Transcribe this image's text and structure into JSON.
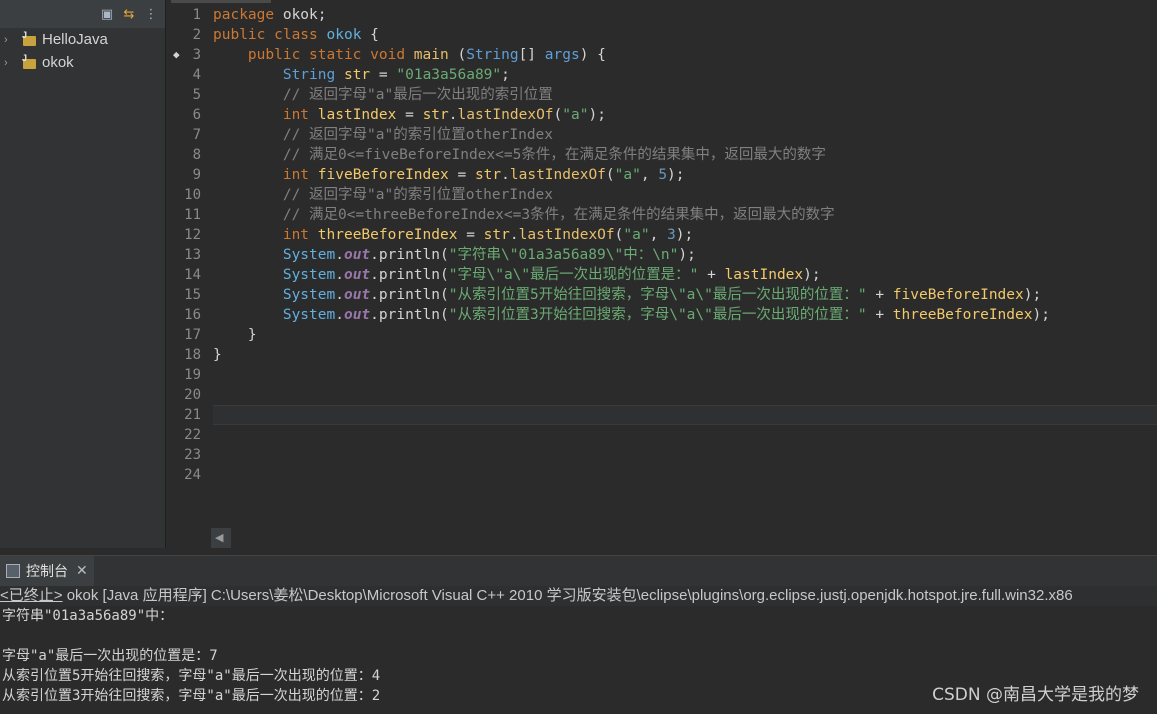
{
  "explorer": {
    "items": [
      {
        "label": "HelloJava"
      },
      {
        "label": "okok"
      }
    ]
  },
  "editor": {
    "line_numbers": [
      "1",
      "2",
      "3",
      "4",
      "5",
      "6",
      "7",
      "8",
      "9",
      "10",
      "11",
      "12",
      "13",
      "14",
      "15",
      "16",
      "17",
      "18",
      "19",
      "20",
      "21",
      "22",
      "23",
      "24"
    ],
    "lines": [
      [
        {
          "t": "package ",
          "c": "kw"
        },
        {
          "t": "okok;",
          "c": ""
        }
      ],
      [
        {
          "t": "public class ",
          "c": "kw"
        },
        {
          "t": "okok",
          "c": "cls"
        },
        {
          "t": " {",
          "c": ""
        }
      ],
      [
        {
          "t": "    public static void ",
          "c": "kw"
        },
        {
          "t": "main",
          "c": "fn"
        },
        {
          "t": " (",
          "c": ""
        },
        {
          "t": "String",
          "c": "type"
        },
        {
          "t": "[] ",
          "c": ""
        },
        {
          "t": "args",
          "c": "type"
        },
        {
          "t": ") {",
          "c": ""
        }
      ],
      [
        {
          "t": "        ",
          "c": ""
        },
        {
          "t": "String",
          "c": "type"
        },
        {
          "t": " ",
          "c": ""
        },
        {
          "t": "str",
          "c": "var"
        },
        {
          "t": " = ",
          "c": ""
        },
        {
          "t": "\"01a3a56a89\"",
          "c": "str"
        },
        {
          "t": ";",
          "c": ""
        }
      ],
      [
        {
          "t": "        // 返回字母\"a\"最后一次出现的索引位置",
          "c": "cm"
        }
      ],
      [
        {
          "t": "        ",
          "c": ""
        },
        {
          "t": "int",
          "c": "kw"
        },
        {
          "t": " ",
          "c": ""
        },
        {
          "t": "lastIndex",
          "c": "var"
        },
        {
          "t": " = ",
          "c": ""
        },
        {
          "t": "str",
          "c": "var"
        },
        {
          "t": ".",
          "c": ""
        },
        {
          "t": "lastIndexOf",
          "c": "fn"
        },
        {
          "t": "(",
          "c": ""
        },
        {
          "t": "\"a\"",
          "c": "str"
        },
        {
          "t": ");",
          "c": ""
        }
      ],
      [
        {
          "t": "        // 返回字母\"a\"的索引位置otherIndex",
          "c": "cm"
        }
      ],
      [
        {
          "t": "        // 满足0<=fiveBeforeIndex<=5条件，在满足条件的结果集中，返回最大的数字",
          "c": "cm"
        }
      ],
      [
        {
          "t": "        ",
          "c": ""
        },
        {
          "t": "int",
          "c": "kw"
        },
        {
          "t": " ",
          "c": ""
        },
        {
          "t": "fiveBeforeIndex",
          "c": "var"
        },
        {
          "t": " = ",
          "c": ""
        },
        {
          "t": "str",
          "c": "var"
        },
        {
          "t": ".",
          "c": ""
        },
        {
          "t": "lastIndexOf",
          "c": "fn"
        },
        {
          "t": "(",
          "c": ""
        },
        {
          "t": "\"a\"",
          "c": "str"
        },
        {
          "t": ", ",
          "c": ""
        },
        {
          "t": "5",
          "c": "num"
        },
        {
          "t": ");",
          "c": ""
        }
      ],
      [
        {
          "t": "        // 返回字母\"a\"的索引位置otherIndex",
          "c": "cm"
        }
      ],
      [
        {
          "t": "        // 满足0<=threeBeforeIndex<=3条件，在满足条件的结果集中，返回最大的数字",
          "c": "cm"
        }
      ],
      [
        {
          "t": "        ",
          "c": ""
        },
        {
          "t": "int",
          "c": "kw"
        },
        {
          "t": " ",
          "c": ""
        },
        {
          "t": "threeBeforeIndex",
          "c": "var"
        },
        {
          "t": " = ",
          "c": ""
        },
        {
          "t": "str",
          "c": "var"
        },
        {
          "t": ".",
          "c": ""
        },
        {
          "t": "lastIndexOf",
          "c": "fn"
        },
        {
          "t": "(",
          "c": ""
        },
        {
          "t": "\"a\"",
          "c": "str"
        },
        {
          "t": ", ",
          "c": ""
        },
        {
          "t": "3",
          "c": "num"
        },
        {
          "t": ");",
          "c": ""
        }
      ],
      [
        {
          "t": "        ",
          "c": ""
        },
        {
          "t": "System",
          "c": "cls"
        },
        {
          "t": ".",
          "c": ""
        },
        {
          "t": "out",
          "c": "fld"
        },
        {
          "t": ".println(",
          "c": ""
        },
        {
          "t": "\"字符串\\\"01a3a56a89\\\"中：\\n\"",
          "c": "str"
        },
        {
          "t": ");",
          "c": ""
        }
      ],
      [
        {
          "t": "        ",
          "c": ""
        },
        {
          "t": "System",
          "c": "cls"
        },
        {
          "t": ".",
          "c": ""
        },
        {
          "t": "out",
          "c": "fld"
        },
        {
          "t": ".println(",
          "c": ""
        },
        {
          "t": "\"字母\\\"a\\\"最后一次出现的位置是：\"",
          "c": "str"
        },
        {
          "t": " + ",
          "c": ""
        },
        {
          "t": "lastIndex",
          "c": "var"
        },
        {
          "t": ");",
          "c": ""
        }
      ],
      [
        {
          "t": "        ",
          "c": ""
        },
        {
          "t": "System",
          "c": "cls"
        },
        {
          "t": ".",
          "c": ""
        },
        {
          "t": "out",
          "c": "fld"
        },
        {
          "t": ".println(",
          "c": ""
        },
        {
          "t": "\"从索引位置5开始往回搜索，字母\\\"a\\\"最后一次出现的位置：\"",
          "c": "str"
        },
        {
          "t": " + ",
          "c": ""
        },
        {
          "t": "fiveBeforeIndex",
          "c": "var"
        },
        {
          "t": ");",
          "c": ""
        }
      ],
      [
        {
          "t": "        ",
          "c": ""
        },
        {
          "t": "System",
          "c": "cls"
        },
        {
          "t": ".",
          "c": ""
        },
        {
          "t": "out",
          "c": "fld"
        },
        {
          "t": ".println(",
          "c": ""
        },
        {
          "t": "\"从索引位置3开始往回搜索，字母\\\"a\\\"最后一次出现的位置：\"",
          "c": "str"
        },
        {
          "t": " + ",
          "c": ""
        },
        {
          "t": "threeBeforeIndex",
          "c": "var"
        },
        {
          "t": ");",
          "c": ""
        }
      ],
      [
        {
          "t": "    }",
          "c": ""
        }
      ],
      [
        {
          "t": "}",
          "c": ""
        }
      ],
      [],
      [],
      [],
      [],
      [],
      []
    ]
  },
  "console": {
    "tab_label": "控制台",
    "status_terminated": "<已终止>",
    "status_rest": " okok [Java 应用程序] C:\\Users\\姜松\\Desktop\\Microsoft Visual C++ 2010 学习版安装包\\eclipse\\plugins\\org.eclipse.justj.openjdk.hotspot.jre.full.win32.x86",
    "output": [
      "字符串\"01a3a56a89\"中：",
      "",
      "字母\"a\"最后一次出现的位置是：7",
      "从索引位置5开始往回搜索，字母\"a\"最后一次出现的位置：4",
      "从索引位置3开始往回搜索，字母\"a\"最后一次出现的位置：2"
    ]
  },
  "watermark": "CSDN @南昌大学是我的梦"
}
